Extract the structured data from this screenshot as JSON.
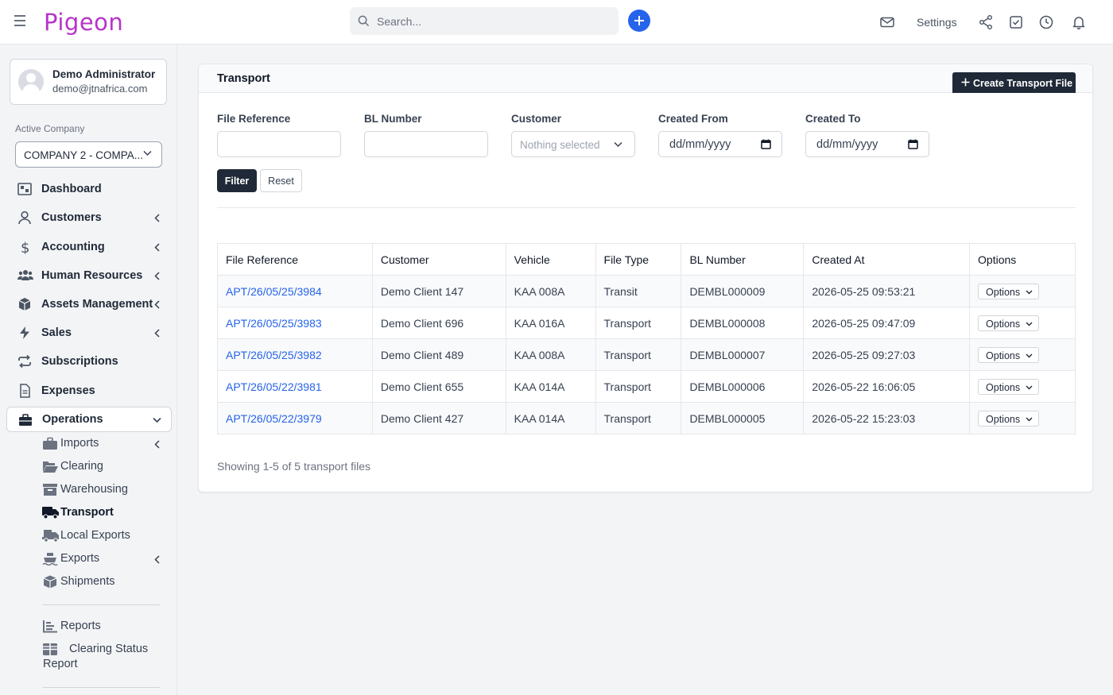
{
  "app": {
    "brand": "Pigeon"
  },
  "topbar": {
    "search_placeholder": "Search...",
    "settings_label": "Settings",
    "icons": [
      "mail-icon",
      "share-icon",
      "check-square-icon",
      "clock-icon",
      "bell-icon"
    ]
  },
  "sidebar": {
    "user": {
      "name": "Demo Administrator",
      "email": "demo@jtnafrica.com"
    },
    "active_company_label": "Active Company",
    "active_company": "COMPANY 2 - COMPA...",
    "nav": [
      {
        "label": "Dashboard",
        "icon": "dashboard-icon"
      },
      {
        "label": "Customers",
        "icon": "user-icon"
      },
      {
        "label": "Accounting",
        "icon": "dollar-icon"
      },
      {
        "label": "Human Resources",
        "icon": "users-icon"
      },
      {
        "label": "Assets Management",
        "icon": "cube-icon"
      },
      {
        "label": "Sales",
        "icon": "bolt-icon"
      },
      {
        "label": "Subscriptions",
        "icon": "repeat-icon"
      },
      {
        "label": "Expenses",
        "icon": "document-icon"
      },
      {
        "label": "Operations",
        "icon": "briefcase-icon"
      }
    ],
    "operations_sub": [
      {
        "label": "Imports",
        "icon": "briefcase-icon"
      },
      {
        "label": "Clearing",
        "icon": "folder-open-icon"
      },
      {
        "label": "Warehousing",
        "icon": "archive-icon"
      },
      {
        "label": "Transport",
        "icon": "truck-icon"
      },
      {
        "label": "Local Exports",
        "icon": "truck-loading-icon"
      },
      {
        "label": "Exports",
        "icon": "ship-icon"
      },
      {
        "label": "Shipments",
        "icon": "box-icon"
      }
    ],
    "reports": [
      {
        "label": "Reports",
        "icon": "bar-chart-icon"
      },
      {
        "label": "Clearing Status",
        "label2": "Report",
        "icon": "table-icon"
      }
    ]
  },
  "page": {
    "title": "Transport",
    "create_button": "Create Transport File",
    "filters": {
      "file_reference": {
        "label": "File Reference",
        "value": ""
      },
      "bl_number": {
        "label": "BL Number",
        "value": ""
      },
      "customer": {
        "label": "Customer",
        "placeholder": "Nothing selected"
      },
      "created_from": {
        "label": "Created From",
        "placeholder": "dd/mm/yyyy"
      },
      "created_to": {
        "label": "Created To",
        "placeholder": "dd/mm/yyyy"
      },
      "filter_button": "Filter",
      "reset_button": "Reset"
    },
    "table": {
      "columns": [
        "File Reference",
        "Customer",
        "Vehicle",
        "File Type",
        "BL Number",
        "Created At",
        "Options"
      ],
      "rows": [
        {
          "ref": "APT/26/05/25/3984",
          "customer": "Demo Client 147",
          "vehicle": "KAA 008A",
          "type": "Transit",
          "bl": "DEMBL000009",
          "created": "2026-05-25 09:53:21",
          "options": "Options"
        },
        {
          "ref": "APT/26/05/25/3983",
          "customer": "Demo Client 696",
          "vehicle": "KAA 016A",
          "type": "Transport",
          "bl": "DEMBL000008",
          "created": "2026-05-25 09:47:09",
          "options": "Options"
        },
        {
          "ref": "APT/26/05/25/3982",
          "customer": "Demo Client 489",
          "vehicle": "KAA 008A",
          "type": "Transport",
          "bl": "DEMBL000007",
          "created": "2026-05-25 09:27:03",
          "options": "Options"
        },
        {
          "ref": "APT/26/05/22/3981",
          "customer": "Demo Client 655",
          "vehicle": "KAA 014A",
          "type": "Transport",
          "bl": "DEMBL000006",
          "created": "2026-05-22 16:06:05",
          "options": "Options"
        },
        {
          "ref": "APT/26/05/22/3979",
          "customer": "Demo Client 427",
          "vehicle": "KAA 014A",
          "type": "Transport",
          "bl": "DEMBL000005",
          "created": "2026-05-22 15:23:03",
          "options": "Options"
        }
      ]
    },
    "showing_text": "Showing 1-5 of 5 transport files"
  },
  "colors": {
    "brand": "#b634c9",
    "primary": "#2563eb",
    "dark_button": "#1f2937"
  }
}
